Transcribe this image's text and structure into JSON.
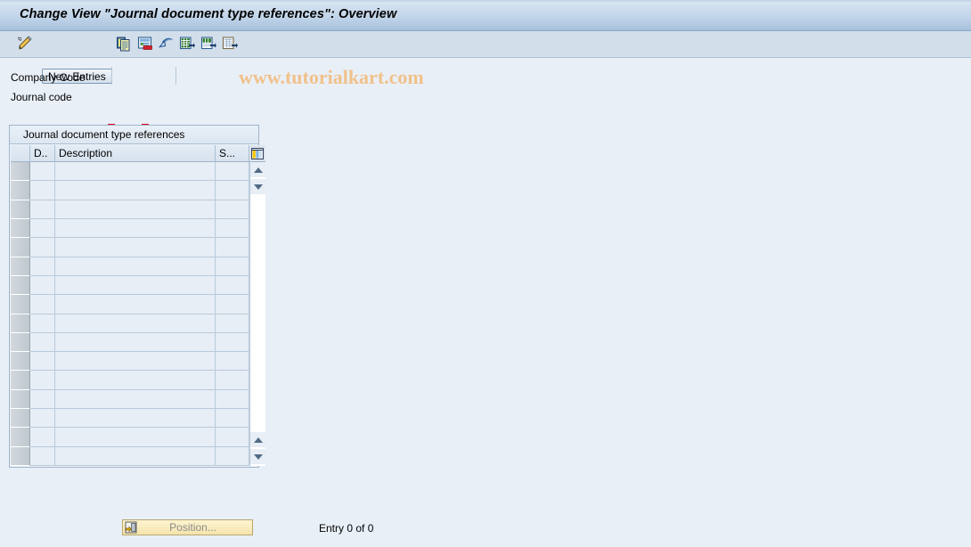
{
  "window": {
    "title": "Change View \"Journal document type references\": Overview"
  },
  "toolbar": {
    "items": [
      {
        "name": "display-change-icon",
        "label": ""
      },
      {
        "name": "new-entries-button",
        "label": "New Entries"
      },
      {
        "name": "copy-as-icon",
        "label": ""
      },
      {
        "name": "delete-icon",
        "label": ""
      },
      {
        "name": "undo-icon",
        "label": ""
      },
      {
        "name": "select-all-icon",
        "label": ""
      },
      {
        "name": "select-block-icon",
        "label": ""
      },
      {
        "name": "deselect-all-icon",
        "label": ""
      }
    ],
    "new_entries_label": "New Entries"
  },
  "watermark": {
    "text": "www.tutorialkart.com",
    "color": "#f0c18a"
  },
  "fields": [
    {
      "label": "Company Code",
      "value": "",
      "required": true,
      "has_matchcode": true
    },
    {
      "label": "Journal code",
      "value": "",
      "required": false,
      "has_matchcode": false
    }
  ],
  "table": {
    "caption": "Journal document type references",
    "columns": [
      {
        "key": "select",
        "label": ""
      },
      {
        "key": "doc_type",
        "label": "D.."
      },
      {
        "key": "description",
        "label": "Description"
      },
      {
        "key": "s_col",
        "label": "S..."
      }
    ],
    "config_icon": "table-settings-icon",
    "rows": [],
    "empty_row_count": 16
  },
  "footer": {
    "position_button_label": "Position...",
    "position_icon": "position-icon",
    "entry_count_text": "Entry 0 of 0"
  },
  "colors": {
    "title_bar_start": "#dce7f3",
    "title_bar_end": "#9fbcd9",
    "toolbar_bg": "#d2dfeb",
    "page_bg": "#e9eff7",
    "required_marker": "#e2001a",
    "grid_line": "#b9cada",
    "cell_bg": "#e8eef6",
    "position_button_bg": "#f9ecc0"
  }
}
